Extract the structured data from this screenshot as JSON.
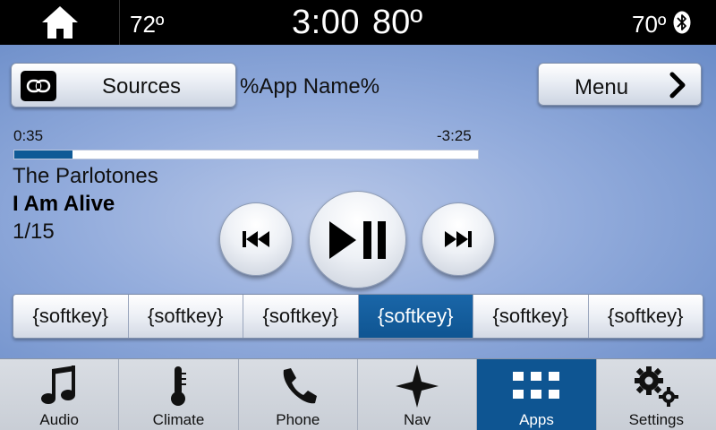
{
  "status_bar": {
    "temp_left": "72º",
    "clock": "3:00",
    "outside_temp": "80º",
    "temp_right": "70º",
    "home_icon": "home-icon",
    "bluetooth_icon": "bluetooth-icon"
  },
  "header": {
    "sources_label": "Sources",
    "sources_icon": "link-icon",
    "app_name": "%App Name%",
    "menu_label": "Menu",
    "menu_icon": "chevron-right-icon"
  },
  "playback": {
    "elapsed": "0:35",
    "remaining": "-3:25",
    "progress": 0.125,
    "artist": "The Parlotones",
    "title": "I Am Alive",
    "track_index": "1/15"
  },
  "controls": {
    "prev_icon": "skip-previous-icon",
    "play_icon": "play-pause-icon",
    "next_icon": "skip-next-icon"
  },
  "softkeys": [
    {
      "label": "{softkey}",
      "active": false
    },
    {
      "label": "{softkey}",
      "active": false
    },
    {
      "label": "{softkey}",
      "active": false
    },
    {
      "label": "{softkey}",
      "active": true
    },
    {
      "label": "{softkey}",
      "active": false
    },
    {
      "label": "{softkey}",
      "active": false
    }
  ],
  "bottom_nav": [
    {
      "label": "Audio",
      "icon": "music-note-icon",
      "active": false
    },
    {
      "label": "Climate",
      "icon": "thermometer-icon",
      "active": false
    },
    {
      "label": "Phone",
      "icon": "phone-icon",
      "active": false
    },
    {
      "label": "Nav",
      "icon": "compass-star-icon",
      "active": false
    },
    {
      "label": "Apps",
      "icon": "apps-grid-icon",
      "active": true
    },
    {
      "label": "Settings",
      "icon": "gears-icon",
      "active": false
    }
  ],
  "colors": {
    "accent": "#0e5592",
    "status_bar": "#000000",
    "background": "#93acdc"
  }
}
